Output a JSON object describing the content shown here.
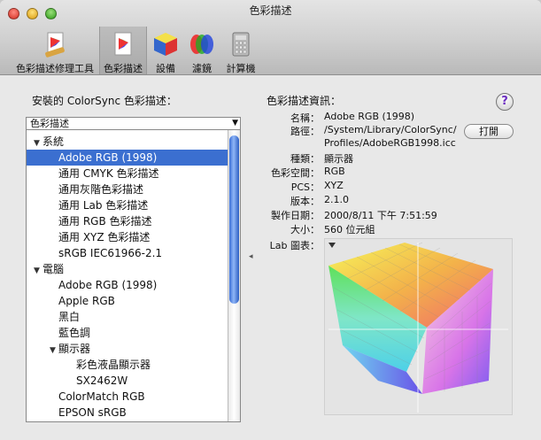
{
  "window": {
    "title": "色彩描述"
  },
  "toolbar": [
    {
      "label": "色彩描述修理工具",
      "icon": "colorsync-utility-icon"
    },
    {
      "label": "色彩描述",
      "icon": "profile-document-icon",
      "selected": true
    },
    {
      "label": "設備",
      "icon": "device-cube-icon"
    },
    {
      "label": "濾鏡",
      "icon": "filter-icon"
    },
    {
      "label": "計算機",
      "icon": "calculator-icon"
    }
  ],
  "left": {
    "heading": "安裝的 ColorSync 色彩描述：",
    "sort_header": "色彩描述",
    "rows": [
      {
        "label": "系統",
        "level": 0,
        "disclosure": "▼"
      },
      {
        "label": "Adobe RGB (1998)",
        "level": 1,
        "selected": true
      },
      {
        "label": "通用 CMYK 色彩描述",
        "level": 1
      },
      {
        "label": "通用灰階色彩描述",
        "level": 1
      },
      {
        "label": "通用 Lab 色彩描述",
        "level": 1
      },
      {
        "label": "通用 RGB 色彩描述",
        "level": 1
      },
      {
        "label": "通用 XYZ 色彩描述",
        "level": 1
      },
      {
        "label": "sRGB IEC61966-2.1",
        "level": 1
      },
      {
        "label": "電腦",
        "level": 0,
        "disclosure": "▼"
      },
      {
        "label": "Adobe RGB (1998)",
        "level": 1
      },
      {
        "label": "Apple RGB",
        "level": 1
      },
      {
        "label": "黑白",
        "level": 1
      },
      {
        "label": "藍色調",
        "level": 1
      },
      {
        "label": "顯示器",
        "level": 1,
        "disclosure": "▼"
      },
      {
        "label": "彩色液晶顯示器",
        "level": 2
      },
      {
        "label": "SX2462W",
        "level": 2
      },
      {
        "label": "ColorMatch RGB",
        "level": 1
      },
      {
        "label": "EPSON  sRGB",
        "level": 1
      }
    ]
  },
  "right": {
    "heading": "色彩描述資訊：",
    "fields": [
      {
        "label": "名稱：",
        "value": "Adobe RGB (1998)"
      },
      {
        "label": "路徑：",
        "value": "/System/Library/ColorSync/",
        "value2": "Profiles/AdobeRGB1998.icc"
      },
      {
        "label": "種類：",
        "value": "顯示器"
      },
      {
        "label": "色彩空間：",
        "value": "RGB"
      },
      {
        "label": "PCS：",
        "value": "XYZ"
      },
      {
        "label": "版本：",
        "value": "2.1.0"
      },
      {
        "label": "製作日期：",
        "value": "2000/8/11 下午 7:51:59"
      },
      {
        "label": "大小：",
        "value": "560 位元組"
      }
    ],
    "open_button": "打開",
    "plot_label": "Lab 圖表：",
    "help": "?"
  }
}
